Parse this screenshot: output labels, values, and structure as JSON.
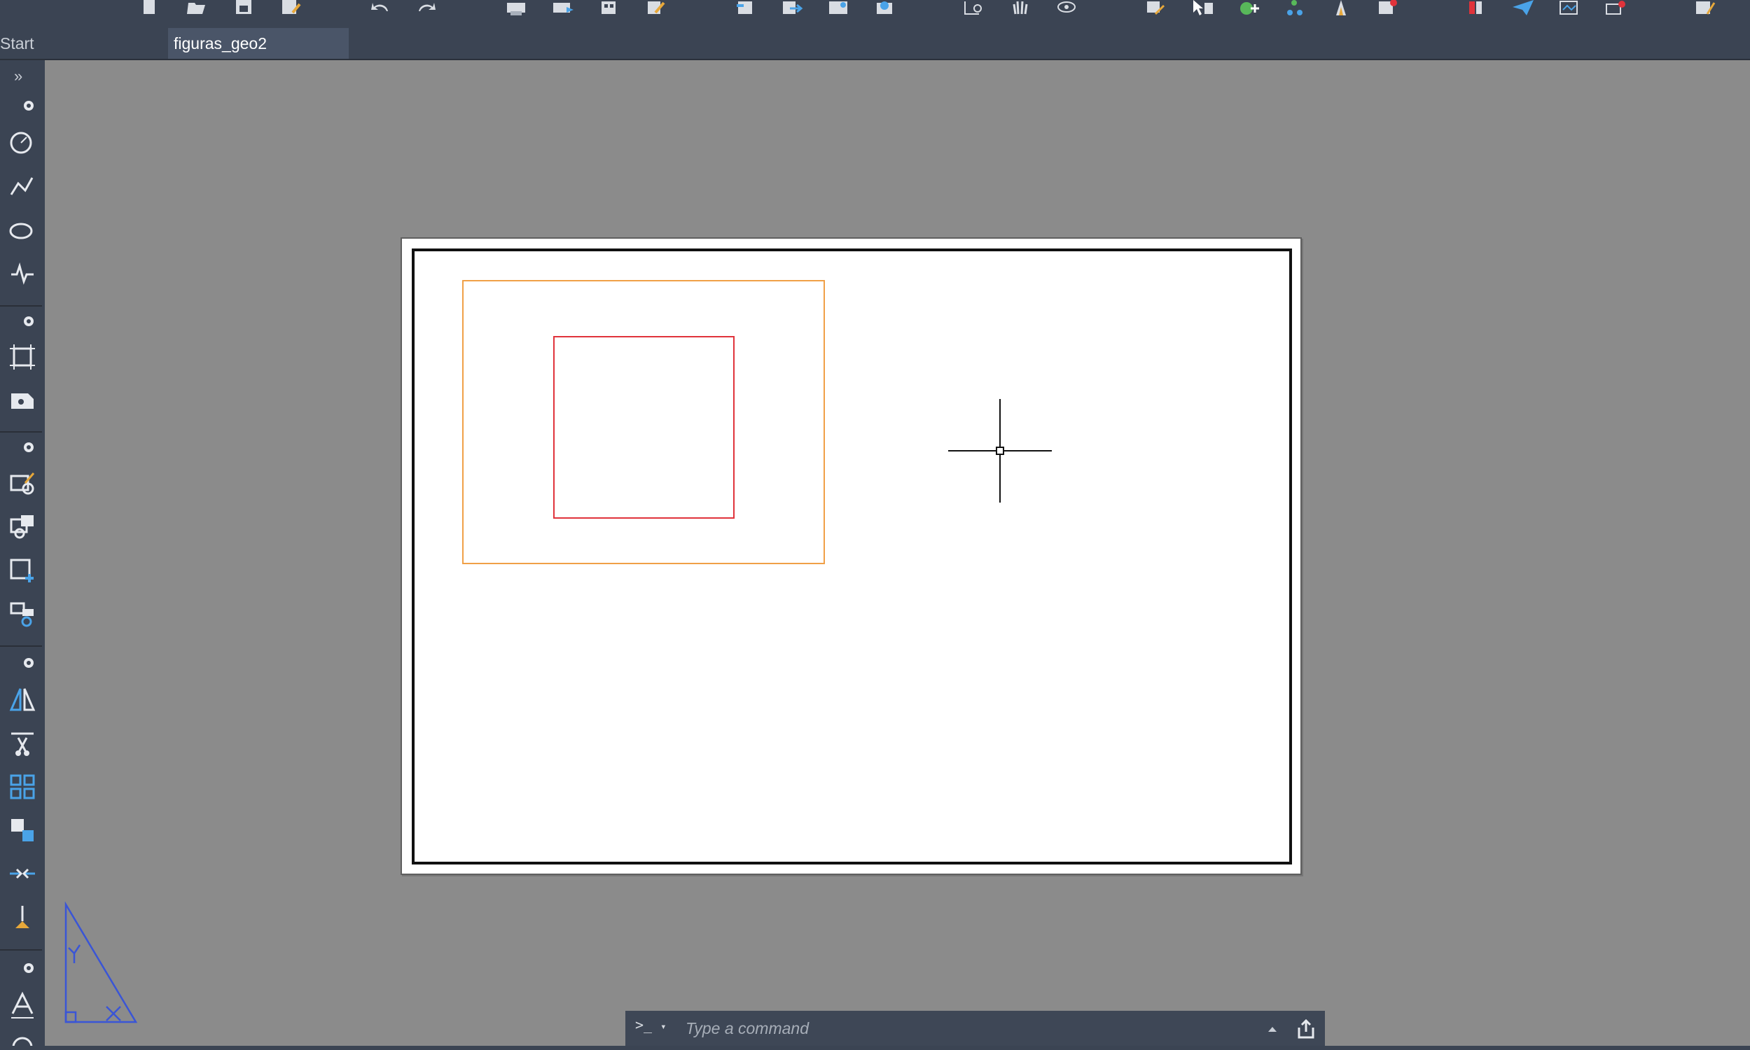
{
  "tabs": [
    {
      "label": "Start",
      "active": false
    },
    {
      "label": "figuras_geo2",
      "active": true
    }
  ],
  "toolbar": {
    "icons": [
      "new-icon",
      "open-icon",
      "save-icon",
      "save-as-icon",
      "undo-icon",
      "redo-icon",
      "plot-icon",
      "publish-icon",
      "sheet-set-icon",
      "edit-icon",
      "import-icon",
      "export-icon",
      "share-icon",
      "cloud-icon",
      "zoom-icon",
      "pan-icon",
      "orbit-icon",
      "properties-icon",
      "select-icon",
      "layer-icon",
      "node-icon",
      "annotate-icon",
      "measure-icon",
      "palette-icon",
      "send-icon",
      "layout-icon",
      "attach-icon",
      "markup-icon"
    ]
  },
  "palette": {
    "toggle_label": "»",
    "groups": [
      [
        "circle-icon",
        "polyline-icon",
        "ellipse-icon",
        "line-icon"
      ],
      [
        "rectangle-frame-icon",
        "insert-block-icon"
      ],
      [
        "edit-block-icon",
        "attribute-icon",
        "create-block-icon",
        "block-refresh-icon"
      ],
      [
        "mirror-icon",
        "trim-icon",
        "array-icon",
        "copy-icon",
        "join-icon",
        "pin-icon"
      ],
      [
        "text-icon",
        "dimension-icon"
      ]
    ]
  },
  "command_line": {
    "prompt": ">_",
    "placeholder": "Type a command"
  },
  "colors": {
    "chrome": "#3b4453",
    "canvas": "#8b8b8b",
    "outer_rect": "#f0a047",
    "inner_rect": "#e0333b",
    "ucs": "#3a55d6",
    "accent": "#4aa3e8"
  }
}
